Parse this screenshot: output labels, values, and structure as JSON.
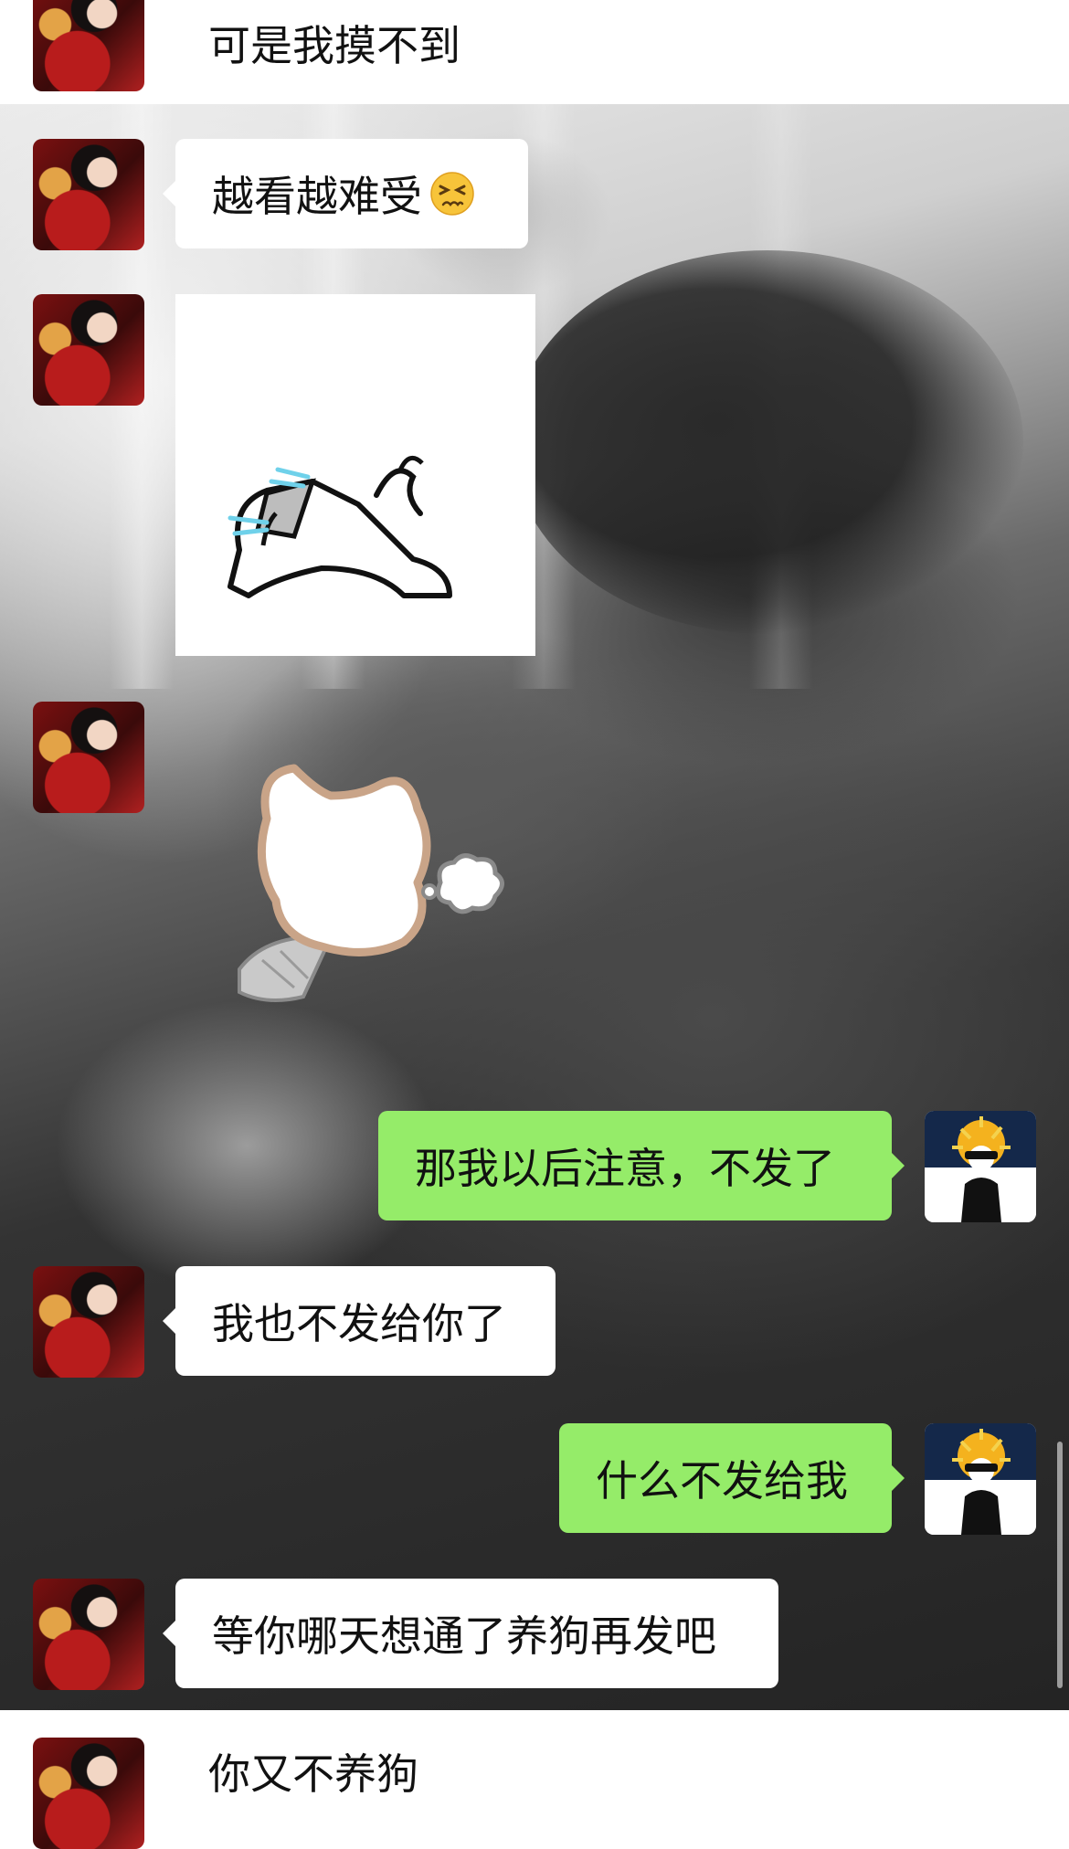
{
  "messages": [
    {
      "sender": "them",
      "text": "可是我摸不到"
    },
    {
      "sender": "them",
      "text": "越看越难受",
      "emoji": "persevering-face-emoji"
    },
    {
      "sender": "them",
      "sticker": "crying-cartoon-sticker"
    },
    {
      "sender": "them",
      "sticker": "fluffy-cat-sigh-sticker"
    },
    {
      "sender": "me",
      "text": "那我以后注意，不发了"
    },
    {
      "sender": "them",
      "text": "我也不发给你了"
    },
    {
      "sender": "me",
      "text": "什么不发给我"
    },
    {
      "sender": "them",
      "text": "等你哪天想通了养狗再发吧"
    },
    {
      "sender": "them",
      "text": "你又不养狗"
    }
  ],
  "colors": {
    "my_bubble": "#95ec69",
    "their_bubble": "#ffffff",
    "text": "#111111"
  }
}
